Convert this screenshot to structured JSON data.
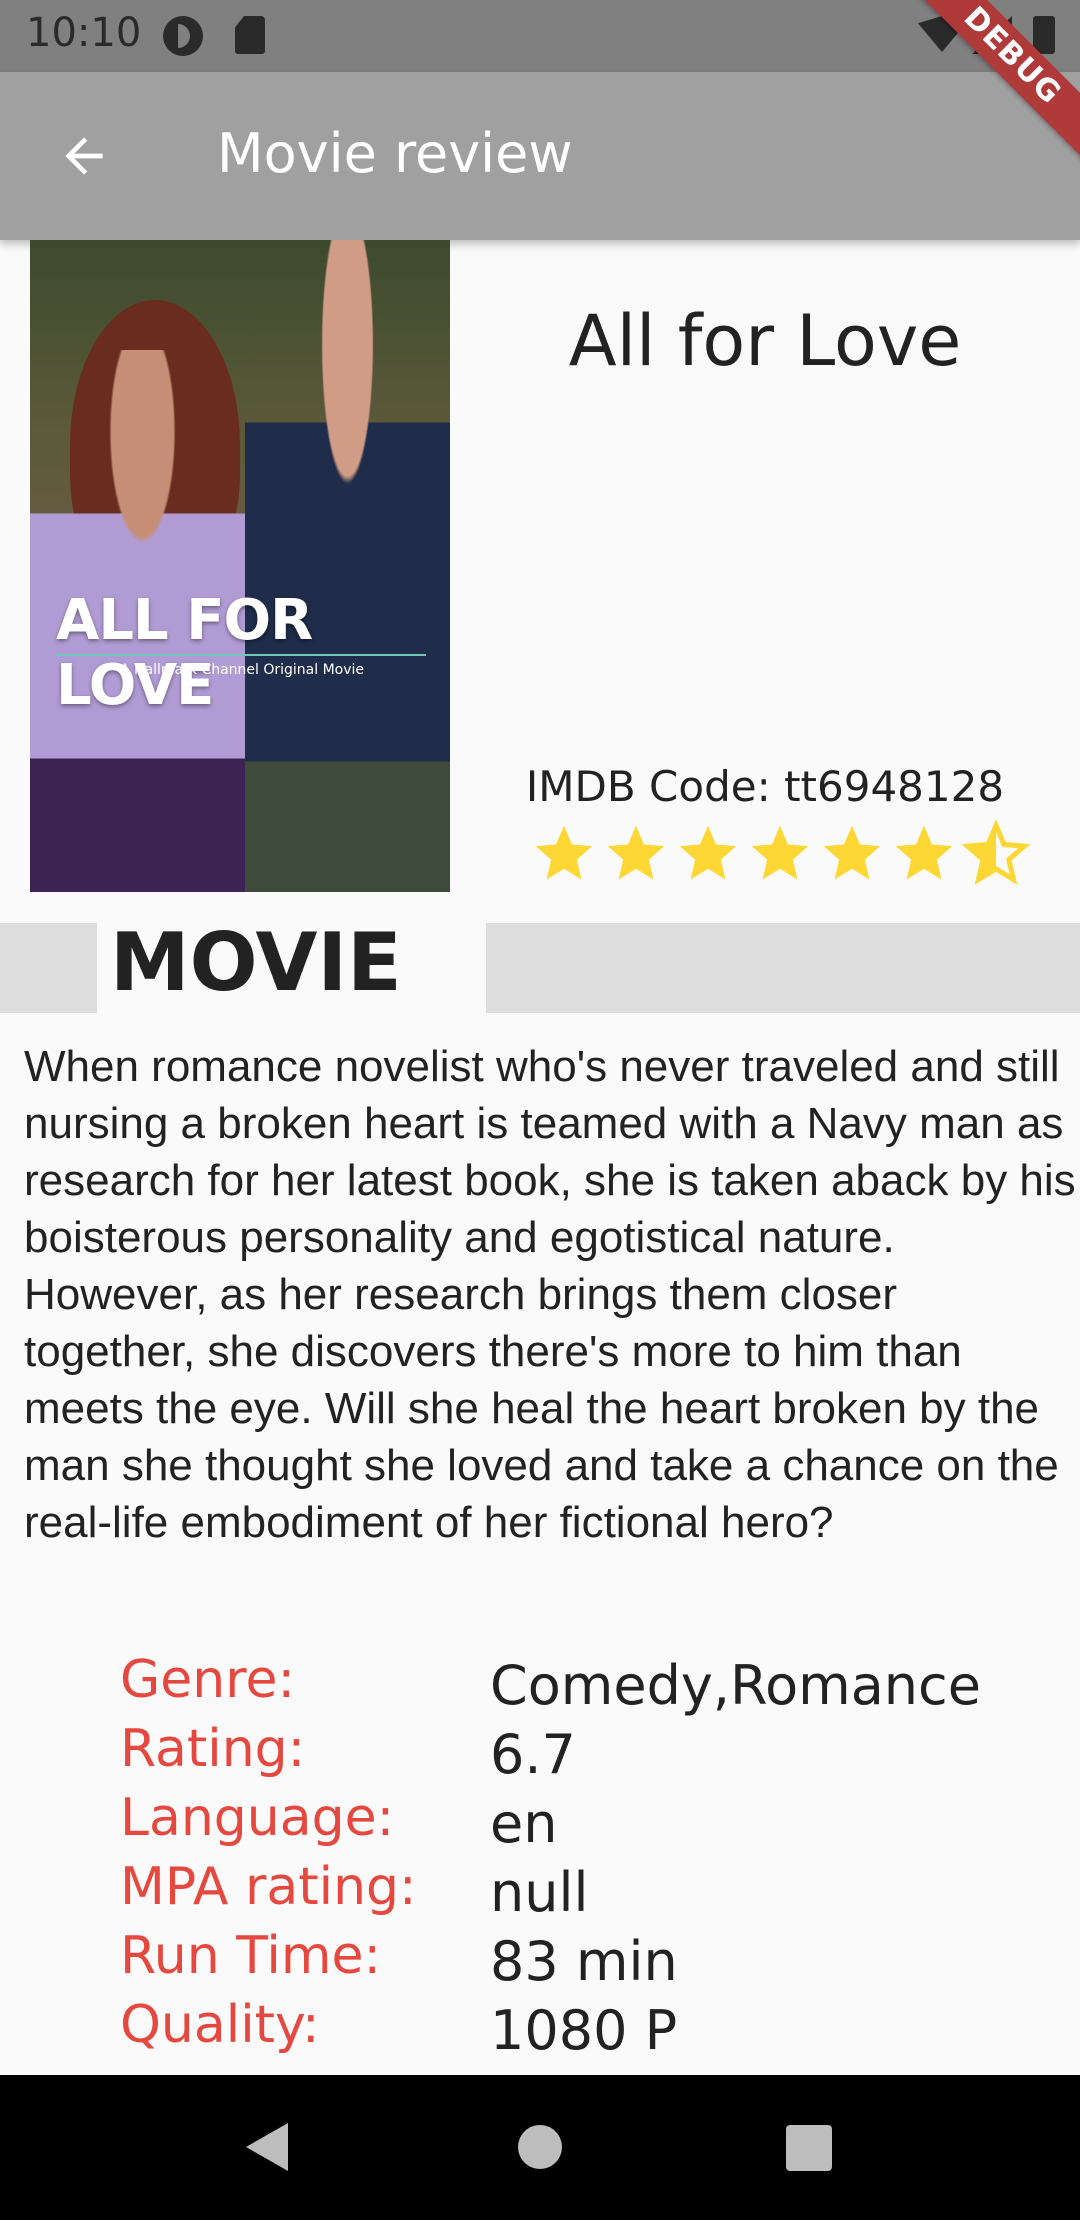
{
  "status_bar": {
    "time": "10:10"
  },
  "app_bar": {
    "title": "Movie review",
    "back_icon": "arrow-back-icon"
  },
  "debug_banner": {
    "label": "DEBUG"
  },
  "poster": {
    "title_text": "ALL FOR LOVE",
    "subtitle_text": "A Hallmark Channel Original Movie"
  },
  "movie": {
    "title": "All for Love",
    "imdb_code": "IMDB Code: tt6948128",
    "stars": {
      "filled": 6,
      "half": 1,
      "max": 7
    }
  },
  "section": {
    "title": "MOVIE"
  },
  "description": "When romance novelist who's never traveled and still nursing a broken heart is teamed with a Navy man as research for her latest book, she is taken aback by his boisterous personality and egotistical nature. However, as her research brings them closer together, she discovers there's more to him than meets the eye. Will she heal the heart broken by the man she thought she loved and take a chance on the real-life embodiment of her fictional hero?",
  "details": [
    {
      "label": "Genre:",
      "value": "Comedy,Romance"
    },
    {
      "label": "Rating:",
      "value": "6.7"
    },
    {
      "label": "Language:",
      "value": "en"
    },
    {
      "label": "MPA rating:",
      "value": "null"
    },
    {
      "label": "Run Time:",
      "value": "83 min"
    },
    {
      "label": "Quality:",
      "value": "1080 P"
    }
  ],
  "colors": {
    "label": "#e5483f",
    "star": "#fdd835",
    "app_bar": "#a0a0a0"
  }
}
